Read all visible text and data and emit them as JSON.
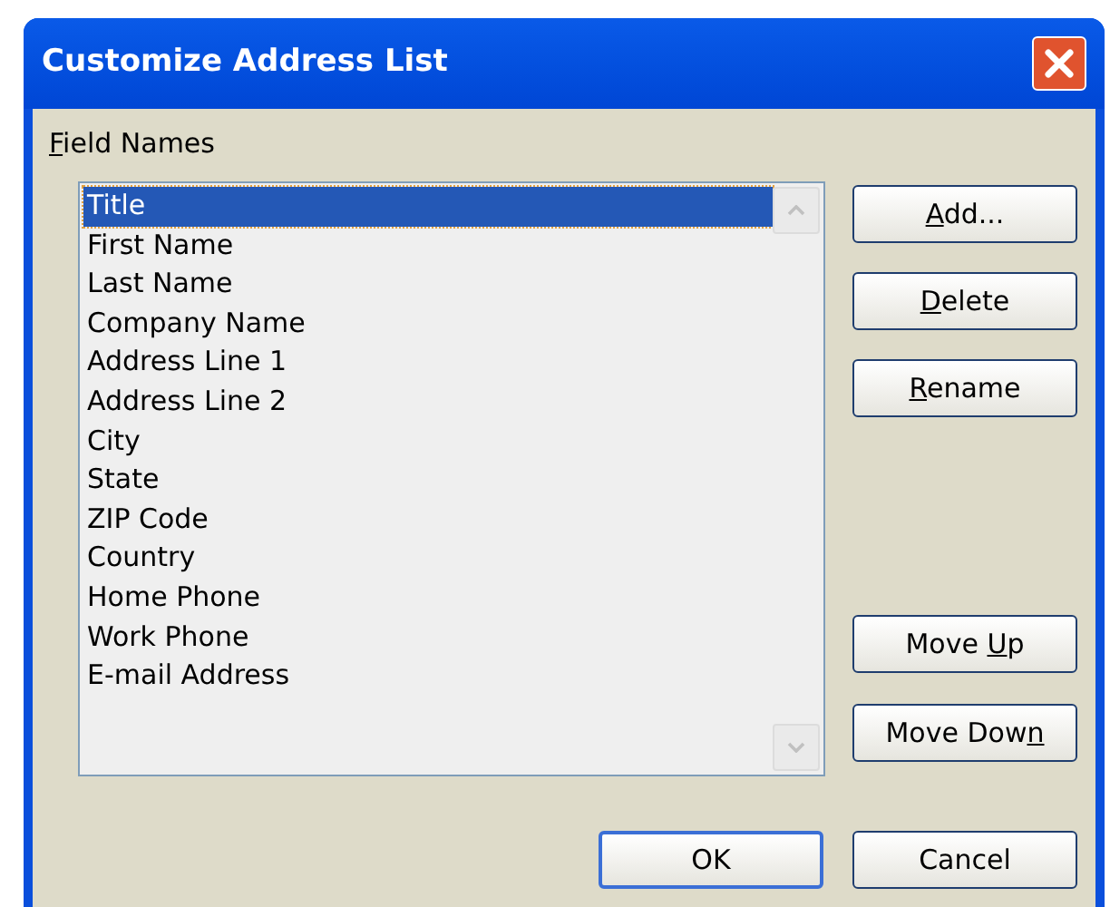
{
  "window": {
    "title": "Customize Address List"
  },
  "field_names": {
    "label": {
      "key": "F",
      "post": "ield Names"
    },
    "items": [
      {
        "label": "Title",
        "selected": true
      },
      {
        "label": "First Name",
        "selected": false
      },
      {
        "label": "Last Name",
        "selected": false
      },
      {
        "label": "Company Name",
        "selected": false
      },
      {
        "label": "Address Line 1",
        "selected": false
      },
      {
        "label": "Address Line 2",
        "selected": false
      },
      {
        "label": "City",
        "selected": false
      },
      {
        "label": "State",
        "selected": false
      },
      {
        "label": "ZIP Code",
        "selected": false
      },
      {
        "label": "Country",
        "selected": false
      },
      {
        "label": "Home Phone",
        "selected": false
      },
      {
        "label": "Work Phone",
        "selected": false
      },
      {
        "label": "E-mail Address",
        "selected": false
      }
    ]
  },
  "side_buttons_top": [
    {
      "key": "A",
      "post": "dd..."
    },
    {
      "key": "D",
      "post": "elete"
    },
    {
      "key": "R",
      "post": "ename"
    }
  ],
  "side_buttons_bottom": [
    {
      "pre": "Move ",
      "key": "U",
      "post": "p"
    },
    {
      "pre": "Move Dow",
      "key": "n"
    }
  ],
  "footer_buttons": [
    {
      "label": "OK",
      "default": true
    },
    {
      "label": "Cancel",
      "default": false
    }
  ]
}
